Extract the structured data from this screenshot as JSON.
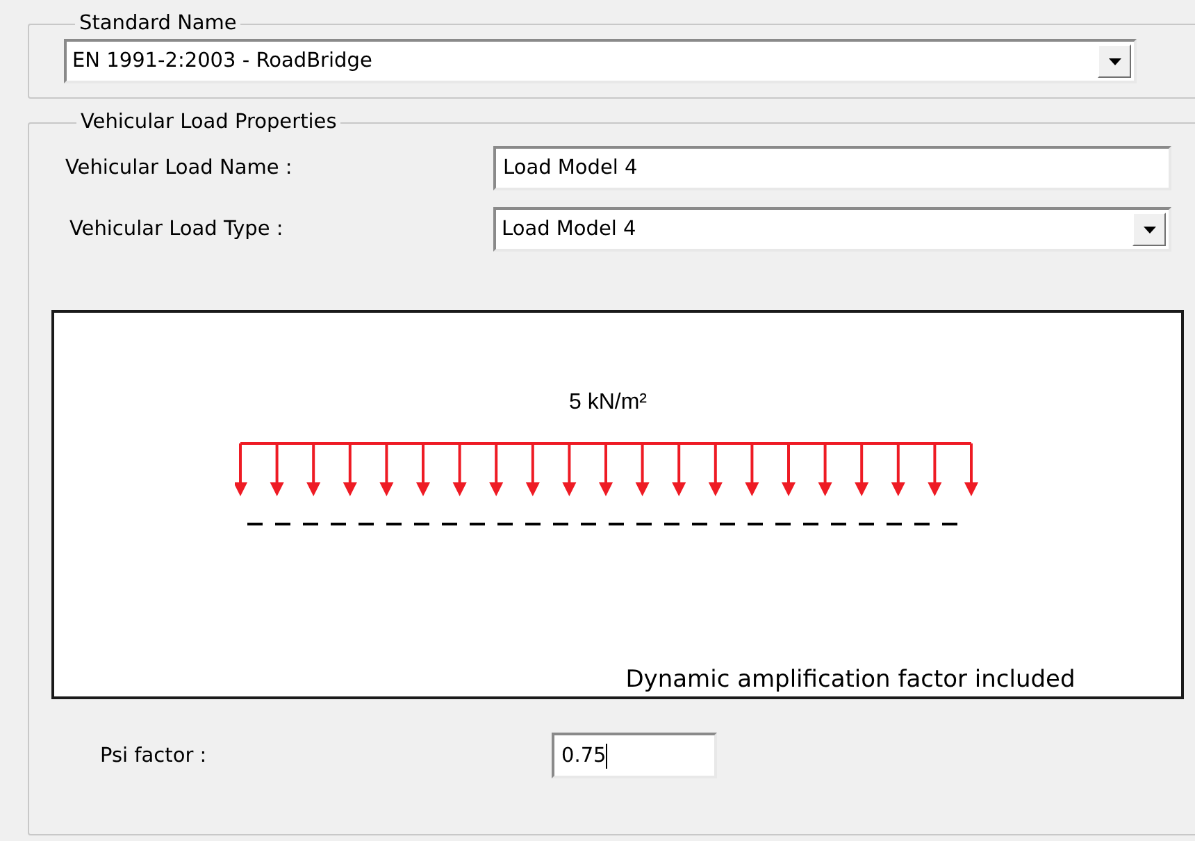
{
  "standard_name": {
    "legend": "Standard Name",
    "value": "EN 1991-2:2003 - RoadBridge"
  },
  "vehicular_load_properties": {
    "legend": "Vehicular Load Properties",
    "fields": [
      {
        "kind": "text",
        "label": "Vehicular Load Name :",
        "value": "Load Model 4"
      },
      {
        "kind": "dropdown",
        "label": "Vehicular Load Type :",
        "value": "Load Model 4"
      }
    ],
    "diagram": {
      "load_label": "5 kN/m²",
      "note": "Dynamic amplification factor included"
    },
    "psi_factor": {
      "label": "Psi factor :",
      "value": "0.75",
      "focused": true
    }
  }
}
